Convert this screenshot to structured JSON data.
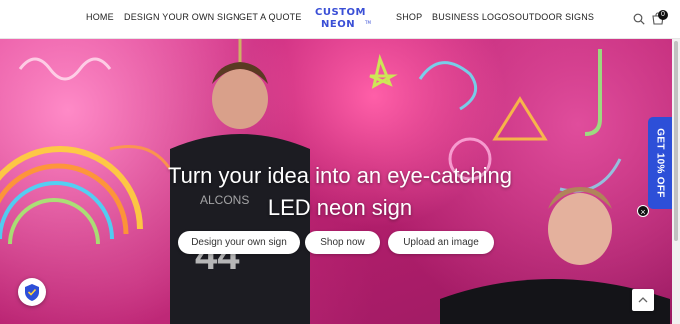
{
  "nav": {
    "left": [
      "HOME",
      "DESIGN YOUR OWN SIGN",
      "GET A QUOTE"
    ],
    "right": [
      "SHOP",
      "BUSINESS LOGOS",
      "OUTDOOR SIGNS"
    ]
  },
  "logo": {
    "line1": "CUSTOM",
    "line2": "NEON",
    "tm": "TM"
  },
  "cart": {
    "count": "0"
  },
  "hero": {
    "headline_line1": "Turn your idea into an eye-catching",
    "headline_line2": "LED neon sign",
    "buttons": [
      "Design your own sign",
      "Shop now",
      "Upload an image"
    ]
  },
  "offer_tab": {
    "label": "GET 10% OFF",
    "close": "×"
  },
  "colors": {
    "brand_blue": "#3a4fd6",
    "offer_blue": "#2d4fd8",
    "hero_pink": "#d8358c"
  },
  "icons": [
    "search-icon",
    "cart-icon",
    "close-icon",
    "shield-badge-icon",
    "chevron-up-icon"
  ]
}
